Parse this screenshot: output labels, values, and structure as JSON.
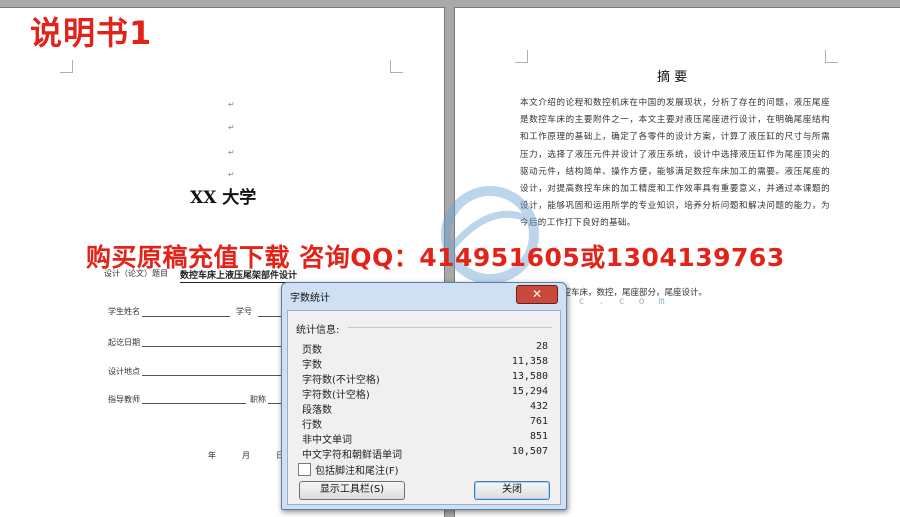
{
  "overlay": {
    "title_watermark": "说明书1",
    "banner": "购买原稿充值下载 咨询QQ：414951605或1304139763",
    "site_url": "w w w . r e n r e n d o c . c o m"
  },
  "left_page": {
    "university": "XX 大学",
    "topic_label": "设计（论文）题目",
    "topic_value": "数控车床上液压尾架部件设计",
    "fields": [
      {
        "label": "学生姓名",
        "label2": "学号"
      },
      {
        "label": "起讫日期"
      },
      {
        "label": "设计地点"
      },
      {
        "label": "指导教师",
        "label2": "职称"
      }
    ],
    "date_chars": [
      "年",
      "月",
      "日"
    ]
  },
  "right_page": {
    "abstract_title": "摘 要",
    "abstract_body": "本文介绍的论程和数控机床在中国的发展现状，分析了存在的问题，液压尾座是数控车床的主要附件之一，本文主要对液压尾座进行设计，在明确尾座结构和工作原理的基础上，确定了各零件的设计方案，计算了液压缸的尺寸与所需压力，选择了液压元件并设计了液压系统，设计中选择液压缸作为尾座顶尖的驱动元件，结构简单、操作方便，能够满足数控车床加工的需要。液压尾座的设计，对提高数控车床的加工精度和工作效率具有重要意义，并通过本课题的设计，能够巩固和运用所学的专业知识，培养分析问题和解决问题的能力，为今后的工作打下良好的基础。",
    "keywords": "关键词：数控车床，数控，尾座部分，尾座设计。"
  },
  "dialog": {
    "title": "字数统计",
    "close_glyph": "✕",
    "group_label": "统计信息:",
    "stats": [
      {
        "label": "页数",
        "value": "28"
      },
      {
        "label": "字数",
        "value": "11,358"
      },
      {
        "label": "字符数(不计空格)",
        "value": "13,580"
      },
      {
        "label": "字符数(计空格)",
        "value": "15,294"
      },
      {
        "label": "段落数",
        "value": "432"
      },
      {
        "label": "行数",
        "value": "761"
      },
      {
        "label": "非中文单词",
        "value": "851"
      },
      {
        "label": "中文字符和朝鲜语单词",
        "value": "10,507"
      }
    ],
    "checkbox_label": "包括脚注和尾注(F)",
    "checkbox_checked": false,
    "toolbar_button": "显示工具栏(S)",
    "close_button": "关闭"
  },
  "colors": {
    "watermark_red": "#e3231a",
    "dialog_frame": "#cfe0f3",
    "close_red": "#c74a3c"
  }
}
